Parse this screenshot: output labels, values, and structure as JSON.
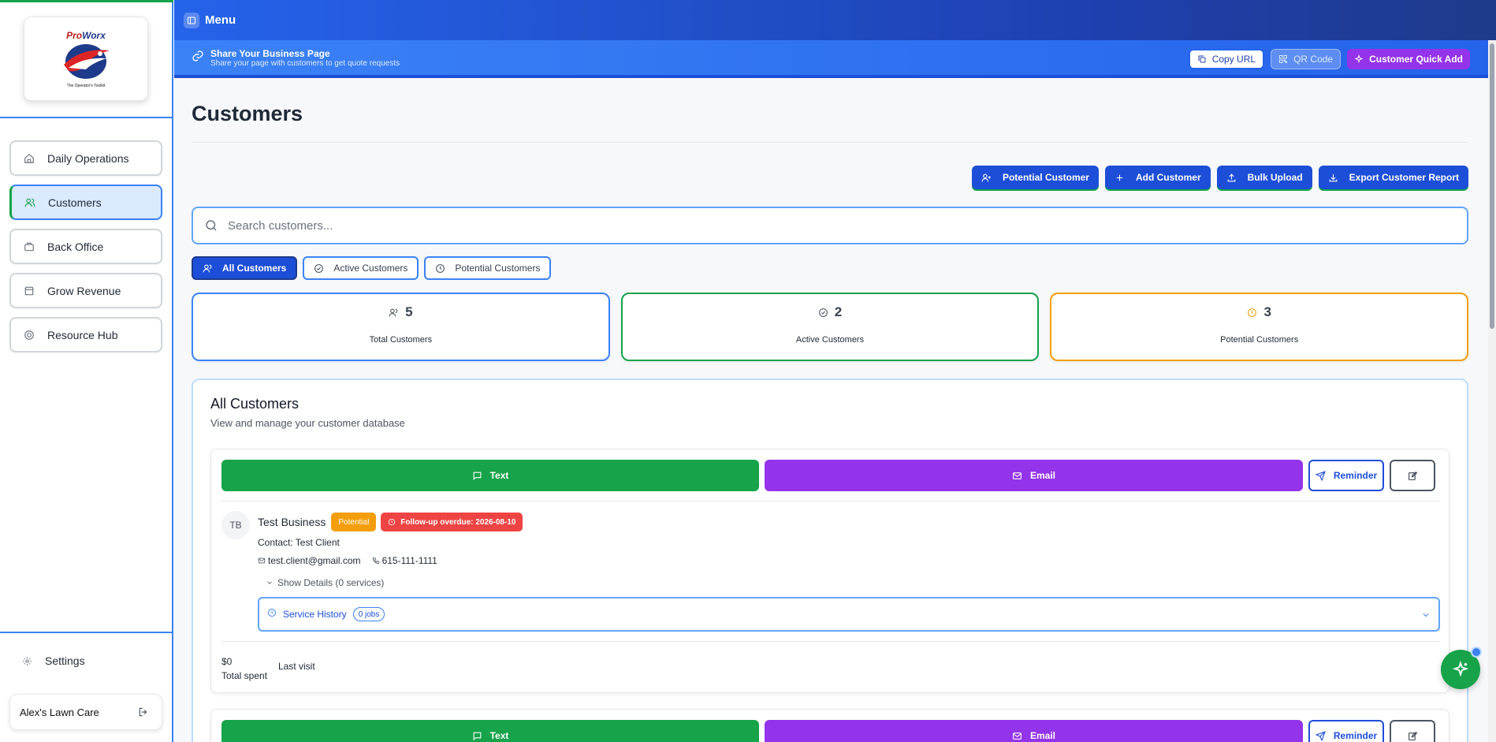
{
  "brand": {
    "logo_title_a": "Pro",
    "logo_title_b": "Worx",
    "logo_tagline": "The Operator's Toolkit"
  },
  "sidebar": {
    "items": [
      {
        "label": "Daily Operations",
        "icon": "home-icon"
      },
      {
        "label": "Customers",
        "icon": "users-icon",
        "active": true
      },
      {
        "label": "Back Office",
        "icon": "briefcase-icon"
      },
      {
        "label": "Grow Revenue",
        "icon": "store-icon"
      },
      {
        "label": "Resource Hub",
        "icon": "lifebuoy-icon"
      }
    ],
    "settings_label": "Settings",
    "account_name": "Alex's Lawn Care"
  },
  "topbar": {
    "menu_label": "Menu"
  },
  "sharebar": {
    "title": "Share Your Business Page",
    "subtitle": "Share your page with customers to get quote requests",
    "copy_url": "Copy URL",
    "qr_code": "QR Code",
    "quick_add": "Customer Quick Add"
  },
  "page": {
    "title": "Customers",
    "actions": {
      "potential": "Potential Customer",
      "add": "Add Customer",
      "bulk": "Bulk Upload",
      "export": "Export Customer Report"
    },
    "search_placeholder": "Search customers...",
    "filters": {
      "all": "All Customers",
      "active": "Active Customers",
      "potential": "Potential Customers"
    },
    "stats": {
      "total": {
        "value": "5",
        "label": "Total Customers"
      },
      "active": {
        "value": "2",
        "label": "Active Customers"
      },
      "potential": {
        "value": "3",
        "label": "Potential Customers"
      }
    },
    "list": {
      "title": "All Customers",
      "subtitle": "View and manage your customer database",
      "buttons": {
        "text": "Text",
        "email": "Email",
        "reminder": "Reminder"
      },
      "customer": {
        "initials": "TB",
        "name": "Test Business",
        "status_badge": "Potential",
        "followup": "Follow-up overdue: 2026-08-10",
        "contact": "Contact: Test Client",
        "email": "test.client@gmail.com",
        "phone": "615-111-1111",
        "show_details": "Show Details (0 services)",
        "service_history": "Service History",
        "jobs": "0 jobs",
        "total_spent_value": "$0",
        "total_spent_label": "Total spent",
        "last_visit_label": "Last visit"
      }
    }
  },
  "colors": {
    "primary": "#1d4ed8",
    "accent_green": "#16a34a",
    "accent_purple": "#9333ea",
    "potential_orange": "#f59e0b",
    "overdue_red": "#ef4444"
  }
}
